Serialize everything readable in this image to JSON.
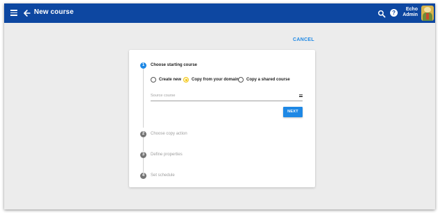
{
  "appbar": {
    "title": "New course",
    "user_line1": "Echo",
    "user_line2": "Admin",
    "menu_icon": "hamburger-menu-icon",
    "back_icon": "arrow-back-icon",
    "search_icon": "search-icon",
    "help_icon": "help-icon",
    "help_glyph": "?",
    "color": "#0d47a1"
  },
  "actions": {
    "cancel_label": "CANCEL"
  },
  "wizard": {
    "steps": [
      {
        "number": "1",
        "label": "Choose starting course",
        "active": true
      },
      {
        "number": "2",
        "label": "Choose copy action",
        "active": false
      },
      {
        "number": "3",
        "label": "Define properties",
        "active": false
      },
      {
        "number": "4",
        "label": "Set schedule",
        "active": false
      }
    ],
    "options": [
      {
        "label": "Create new",
        "selected": false
      },
      {
        "label": "Copy from your domain",
        "selected": true
      },
      {
        "label": "Copy a shared course",
        "selected": false
      }
    ],
    "source_placeholder": "Source course",
    "source_icon": "list-icon",
    "next_label": "NEXT",
    "accent": "#1e88e5",
    "selected_color": "#f2c417"
  }
}
